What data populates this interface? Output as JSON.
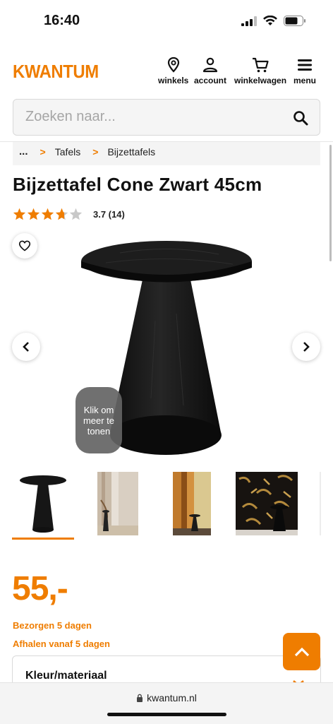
{
  "status_bar": {
    "time": "16:40"
  },
  "header": {
    "logo": "KWANTUM",
    "nav": [
      {
        "label": "winkels",
        "icon": "location-pin-icon"
      },
      {
        "label": "account",
        "icon": "person-icon"
      },
      {
        "label": "winkelwagen",
        "icon": "cart-icon"
      },
      {
        "label": "menu",
        "icon": "hamburger-icon"
      }
    ]
  },
  "search": {
    "placeholder": "Zoeken naar..."
  },
  "breadcrumb": {
    "ellipsis": "...",
    "items": [
      "Tafels",
      "Bijzettafels"
    ]
  },
  "product": {
    "title": "Bijzettafel Cone Zwart 45cm",
    "rating_value": 3.7,
    "rating_text": "3.7 (14)",
    "gallery_hint": "Klik om meer te tonen",
    "price": "55,-",
    "delivery": "Bezorgen 5 dagen",
    "pickup": "Afhalen vanaf 5 dagen",
    "option_label": "Kleur/materiaal"
  },
  "browser": {
    "url": "kwantum.nl"
  },
  "colors": {
    "brand": "#ef7d00",
    "star_empty": "#c8c8c8"
  }
}
